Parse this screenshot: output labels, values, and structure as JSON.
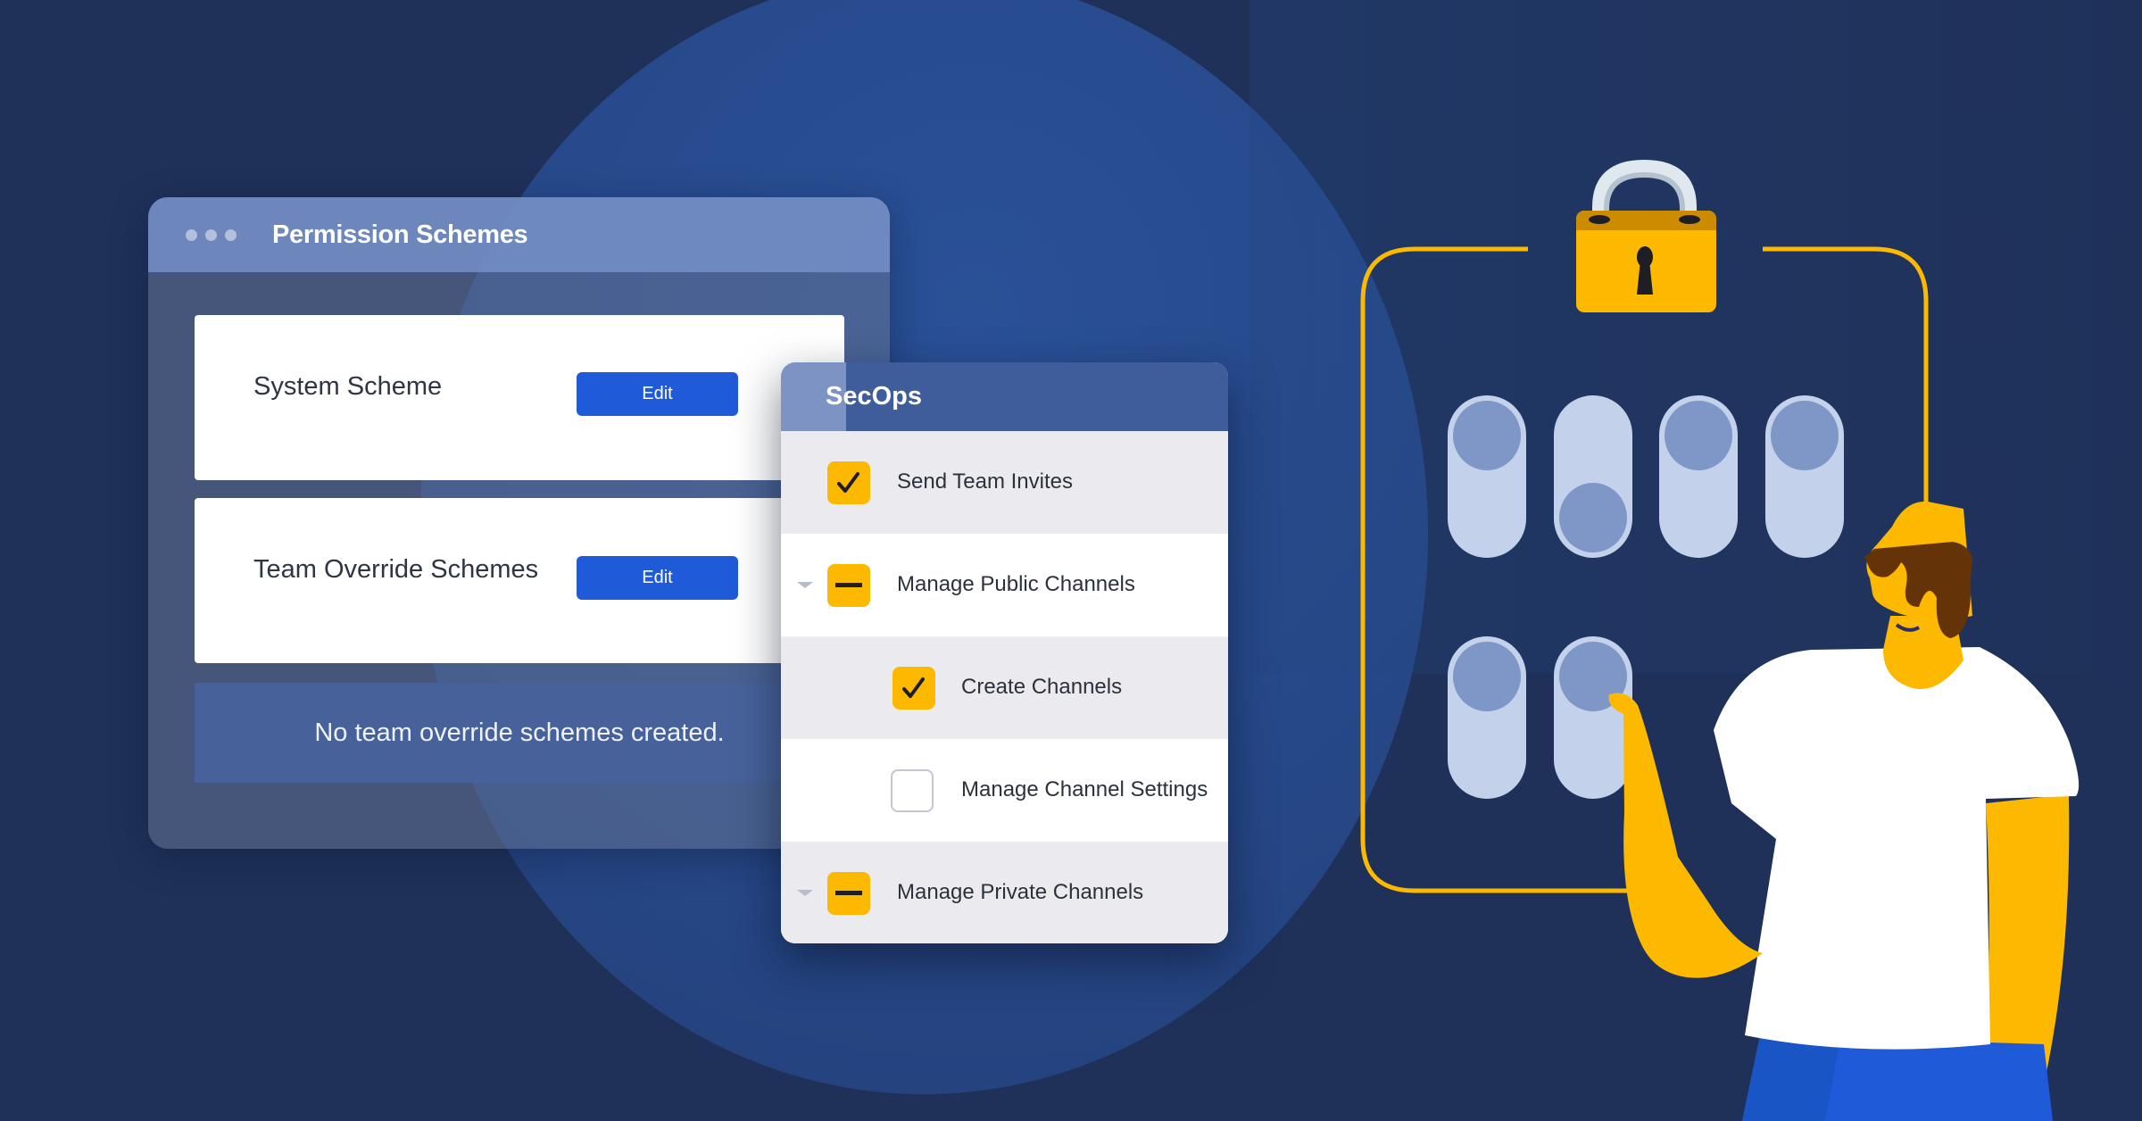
{
  "permission_schemes_window": {
    "title": "Permission Schemes",
    "window_controls_icon": "three-dots-icon",
    "cards": [
      {
        "label": "System Scheme",
        "button_label": "Edit"
      },
      {
        "label": "Team Override Schemes",
        "button_label": "Edit"
      }
    ],
    "empty_message": "No team override schemes created."
  },
  "secops_panel": {
    "title": "SecOps",
    "permissions": [
      {
        "label": "Send Team Invites",
        "state": "checked",
        "expandable": false,
        "indent": 0
      },
      {
        "label": "Manage Public Channels",
        "state": "partial",
        "expandable": true,
        "indent": 0
      },
      {
        "label": "Create Channels",
        "state": "checked",
        "expandable": false,
        "indent": 1
      },
      {
        "label": "Manage Channel Settings",
        "state": "unchecked",
        "expandable": false,
        "indent": 1
      },
      {
        "label": "Manage Private Channels",
        "state": "partial",
        "expandable": true,
        "indent": 0
      }
    ]
  },
  "illustration": {
    "lock_icon": "padlock-icon",
    "toggles": [
      {
        "row": 1,
        "state": "up"
      },
      {
        "row": 1,
        "state": "down"
      },
      {
        "row": 1,
        "state": "up"
      },
      {
        "row": 1,
        "state": "up"
      },
      {
        "row": 2,
        "state": "up"
      },
      {
        "row": 2,
        "state": "up"
      }
    ],
    "person": "person-pressing-toggle"
  },
  "colors": {
    "background": "#1f3159",
    "accent_yellow": "#fcb900",
    "edit_button": "#1f5ad9",
    "secops_header": "#3f5d9b",
    "toggle_track": "#c3d1eb",
    "toggle_knob": "#7f97c7"
  }
}
